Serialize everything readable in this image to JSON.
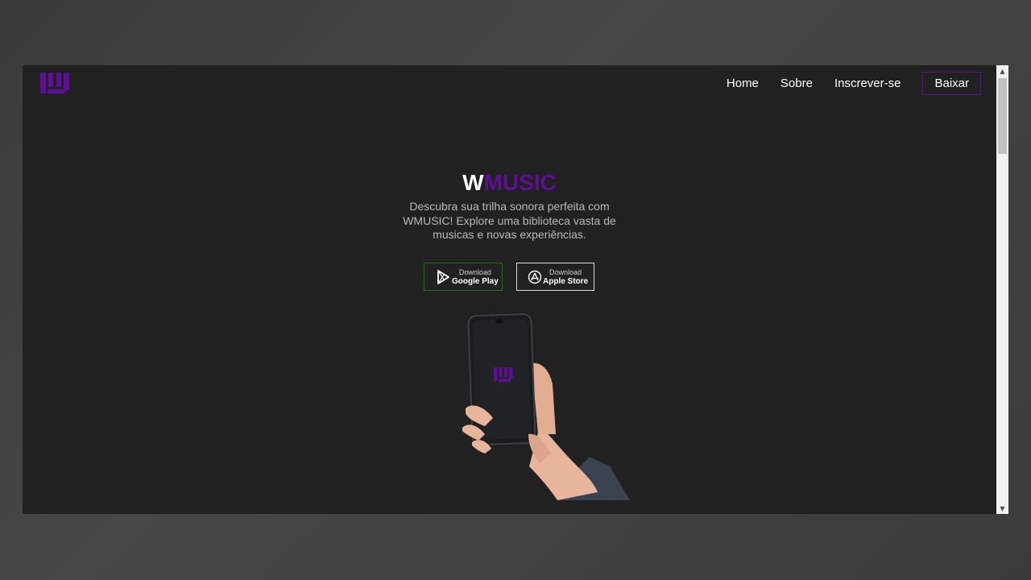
{
  "brand": {
    "logo_icon": "wmusic-logo-icon",
    "purple": "#5e0f97"
  },
  "nav": {
    "items": [
      {
        "label": "Home"
      },
      {
        "label": "Sobre"
      },
      {
        "label": "Inscrever-se"
      }
    ],
    "cta_label": "Baixar"
  },
  "hero": {
    "title_part1": "W",
    "title_part2": "MUSIC",
    "description": "Descubra sua trilha sonora perfeita com WMUSIC! Explore uma biblioteca vasta de musicas e novas experiências."
  },
  "downloads": {
    "google_play": {
      "small": "Download",
      "big": "Google Play",
      "icon": "google-play-icon",
      "border_color": "#0c7a0c"
    },
    "apple_store": {
      "small": "Download",
      "big": "Apple Store",
      "icon": "app-store-icon",
      "border_color": "#d9d9d9"
    }
  },
  "illustration": {
    "icon": "hand-holding-phone-image"
  }
}
